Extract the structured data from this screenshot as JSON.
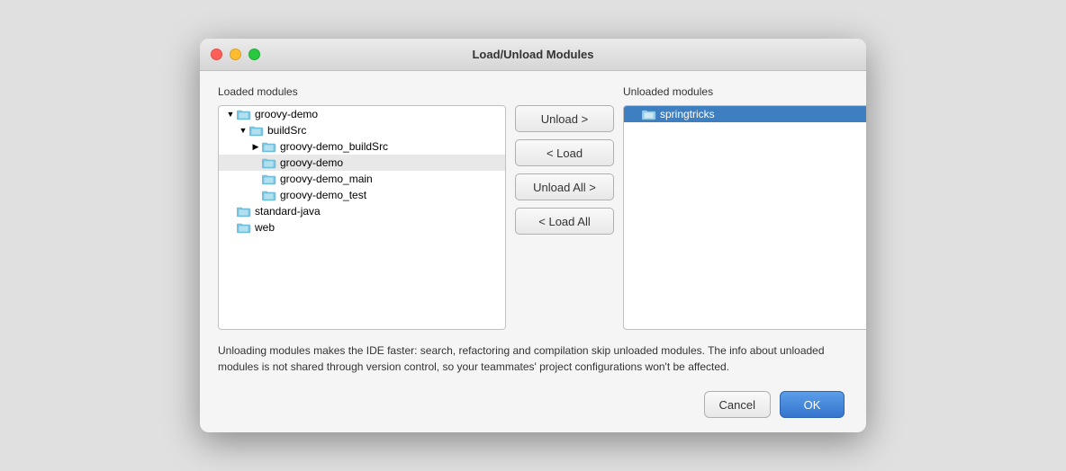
{
  "window": {
    "title": "Load/Unload Modules"
  },
  "loaded_panel": {
    "label": "Loaded modules",
    "items": [
      {
        "id": "groovy-demo-root",
        "indent": 1,
        "expanded": true,
        "expandable": true,
        "text": "groovy-demo"
      },
      {
        "id": "buildSrc",
        "indent": 2,
        "expanded": true,
        "expandable": true,
        "text": "buildSrc"
      },
      {
        "id": "groovy-demo-buildSrc",
        "indent": 3,
        "expanded": false,
        "expandable": true,
        "text": "groovy-demo_buildSrc"
      },
      {
        "id": "groovy-demo-inner",
        "indent": 3,
        "expandable": false,
        "text": "groovy-demo",
        "highlighted": true
      },
      {
        "id": "groovy-demo-main",
        "indent": 3,
        "expandable": false,
        "text": "groovy-demo_main"
      },
      {
        "id": "groovy-demo-test",
        "indent": 3,
        "expandable": false,
        "text": "groovy-demo_test"
      },
      {
        "id": "standard-java",
        "indent": 1,
        "expandable": false,
        "text": "standard-java"
      },
      {
        "id": "web",
        "indent": 1,
        "expandable": false,
        "text": "web"
      }
    ]
  },
  "buttons": {
    "unload": "Unload >",
    "load": "< Load",
    "unload_all": "Unload All >",
    "load_all": "< Load All"
  },
  "unloaded_panel": {
    "label": "Unloaded modules",
    "items": [
      {
        "id": "springtricks",
        "indent": 1,
        "expandable": false,
        "text": "springtricks",
        "selected": true
      }
    ]
  },
  "info_text": "Unloading modules makes the IDE faster: search, refactoring and compilation skip unloaded modules. The info about unloaded modules is not shared through version control, so your teammates' project configurations won't be affected.",
  "footer": {
    "cancel_label": "Cancel",
    "ok_label": "OK"
  },
  "colors": {
    "selected_bg": "#3d7fc1",
    "highlighted_bg": "#e8e8e8",
    "ok_bg": "#3575ce"
  }
}
